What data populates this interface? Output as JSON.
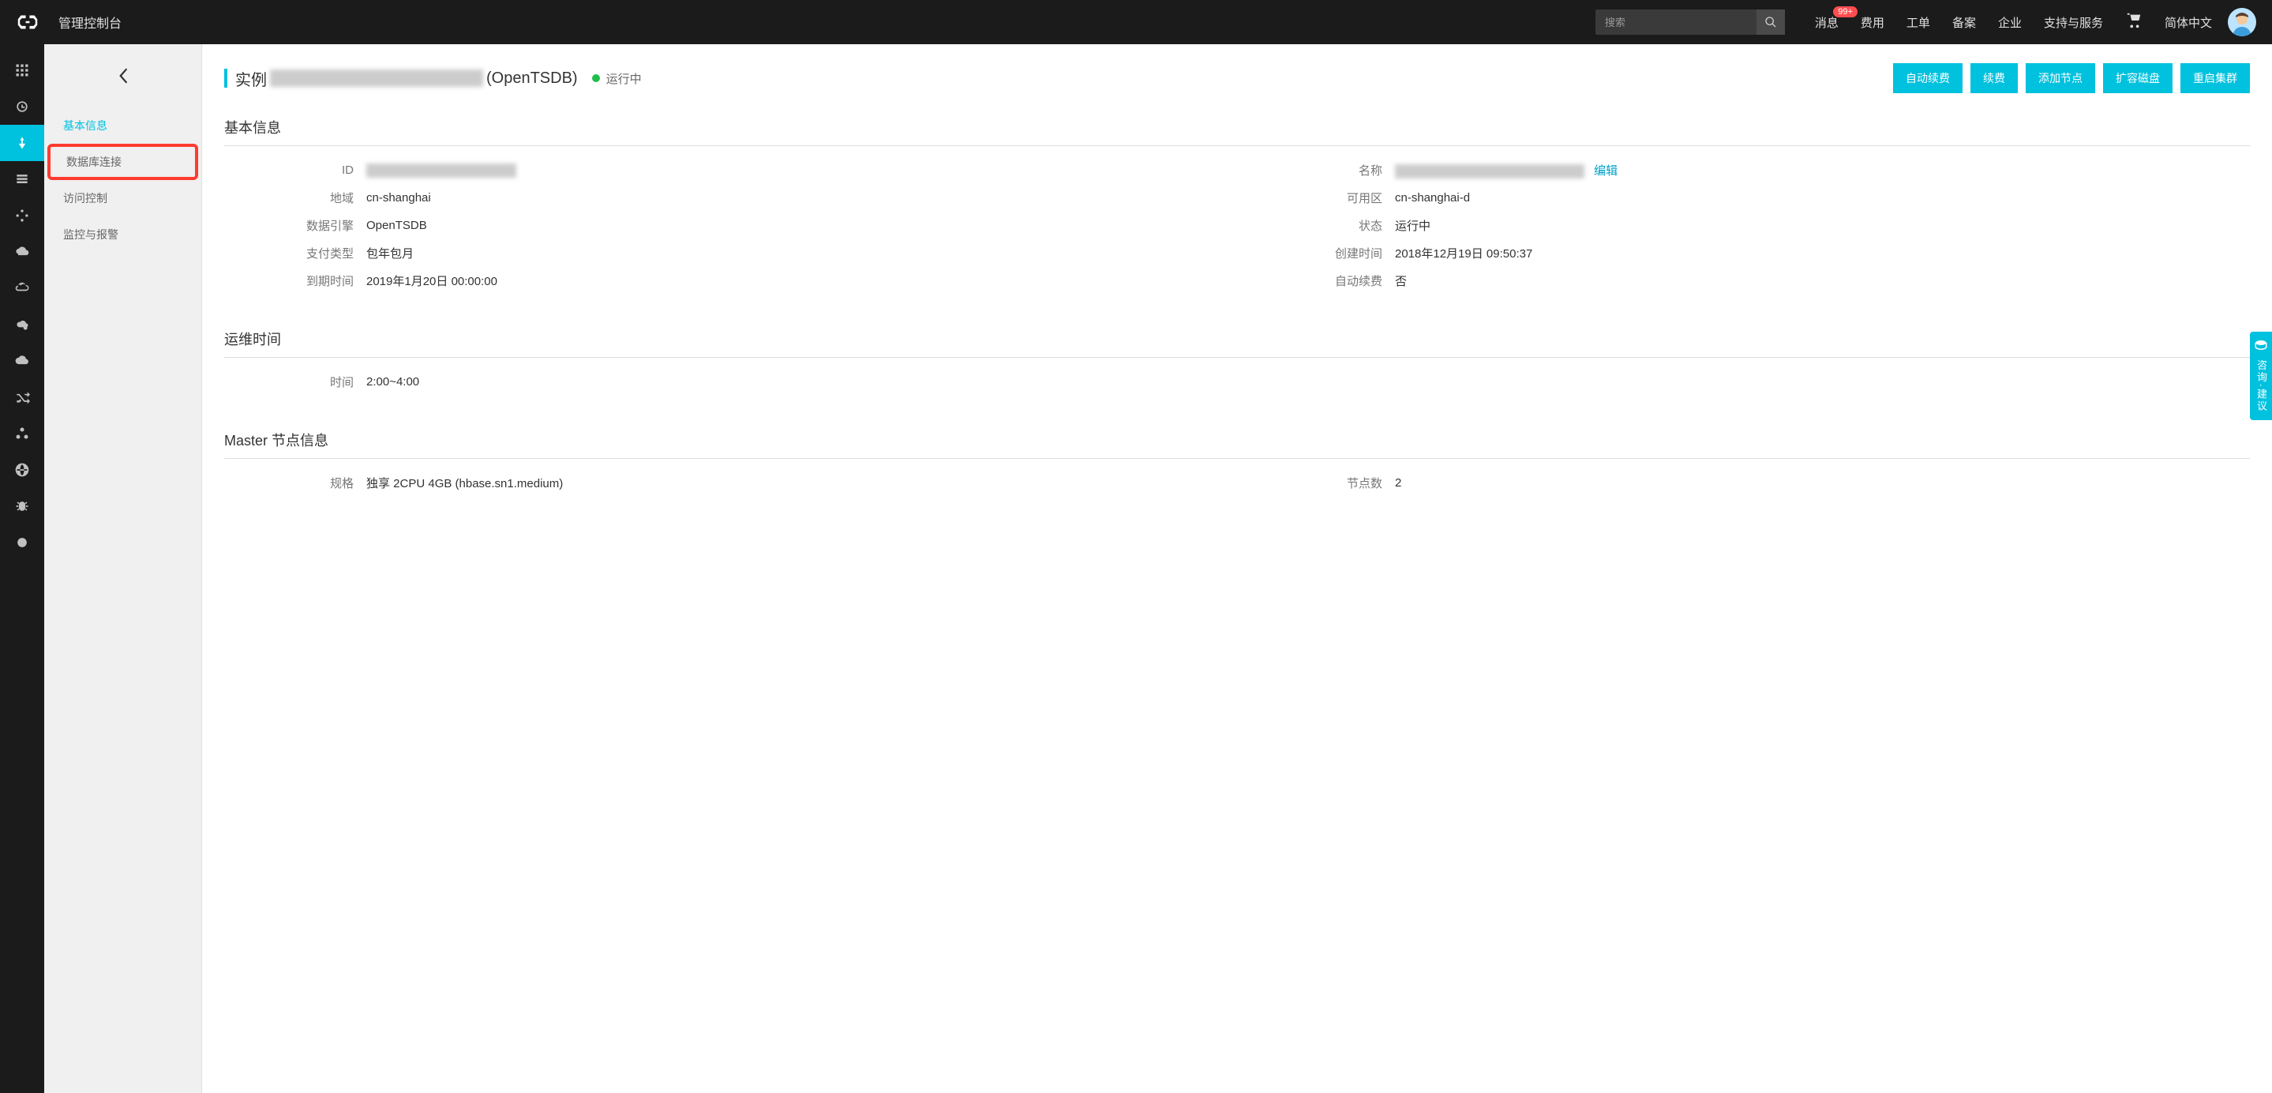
{
  "header": {
    "console_title": "管理控制台",
    "search_placeholder": "搜索",
    "nav": {
      "messages": "消息",
      "messages_badge": "99+",
      "billing": "费用",
      "tickets": "工单",
      "beian": "备案",
      "enterprise": "企业",
      "support": "支持与服务"
    },
    "language": "简体中文"
  },
  "menu_sidebar": {
    "items": [
      {
        "label": "基本信息",
        "active": true,
        "highlighted": false
      },
      {
        "label": "数据库连接",
        "active": false,
        "highlighted": true
      },
      {
        "label": "访问控制",
        "active": false,
        "highlighted": false
      },
      {
        "label": "监控与报警",
        "active": false,
        "highlighted": false
      }
    ]
  },
  "page": {
    "title_prefix": "实例",
    "title_suffix": "(OpenTSDB)",
    "status_text": "运行中",
    "actions": {
      "auto_renew": "自动续费",
      "renew": "续费",
      "add_node": "添加节点",
      "expand_disk": "扩容磁盘",
      "restart_cluster": "重启集群"
    }
  },
  "sections": {
    "basic_info": {
      "title": "基本信息",
      "fields": {
        "id_label": "ID",
        "name_label": "名称",
        "name_edit": "编辑",
        "region_label": "地域",
        "region_value": "cn-shanghai",
        "zone_label": "可用区",
        "zone_value": "cn-shanghai-d",
        "engine_label": "数据引擎",
        "engine_value": "OpenTSDB",
        "status_label": "状态",
        "status_value": "运行中",
        "payment_label": "支付类型",
        "payment_value": "包年包月",
        "created_label": "创建时间",
        "created_value": "2018年12月19日 09:50:37",
        "expire_label": "到期时间",
        "expire_value": "2019年1月20日 00:00:00",
        "auto_renew_label": "自动续费",
        "auto_renew_value": "否"
      }
    },
    "ops_time": {
      "title": "运维时间",
      "time_label": "时间",
      "time_value": "2:00~4:00"
    },
    "master_node": {
      "title": "Master 节点信息",
      "spec_label": "规格",
      "spec_value": "独享 2CPU 4GB (hbase.sn1.medium)",
      "count_label": "节点数",
      "count_value": "2"
    }
  },
  "side_help": {
    "text": "咨询·建议"
  }
}
